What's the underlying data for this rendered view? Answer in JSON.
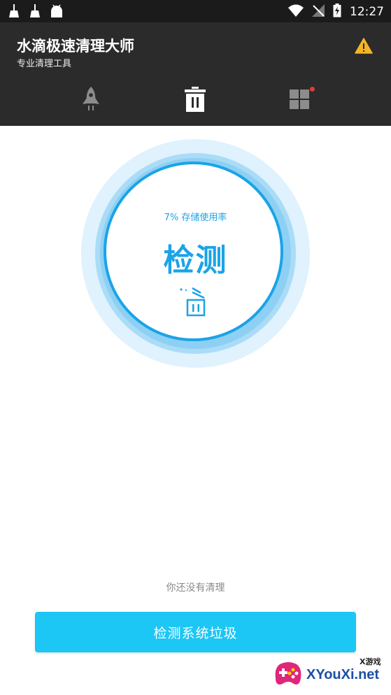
{
  "status_bar": {
    "time": "12:27",
    "left_icons": [
      "broom-icon",
      "broom-icon",
      "android-icon"
    ],
    "right_icons": [
      "wifi-icon",
      "no-signal-icon",
      "battery-charging-icon"
    ]
  },
  "header": {
    "title": "水滴极速清理大师",
    "subtitle": "专业清理工具",
    "warning_icon": "warning-icon",
    "background": "#2b2b2b"
  },
  "tabs": [
    {
      "icon": "rocket-icon",
      "active": false
    },
    {
      "icon": "trash-icon",
      "active": true
    },
    {
      "icon": "grid-icon",
      "active": false,
      "badge": true
    }
  ],
  "gauge": {
    "usage_text": "7% 存储使用率",
    "label": "检测",
    "accent": "#1aa3e8"
  },
  "footer": {
    "status_text": "你还没有清理",
    "scan_button_label": "检测系统垃圾",
    "button_color": "#1cc6f5"
  },
  "watermark": {
    "text": "XYouXi.net",
    "small": "X游戏"
  }
}
